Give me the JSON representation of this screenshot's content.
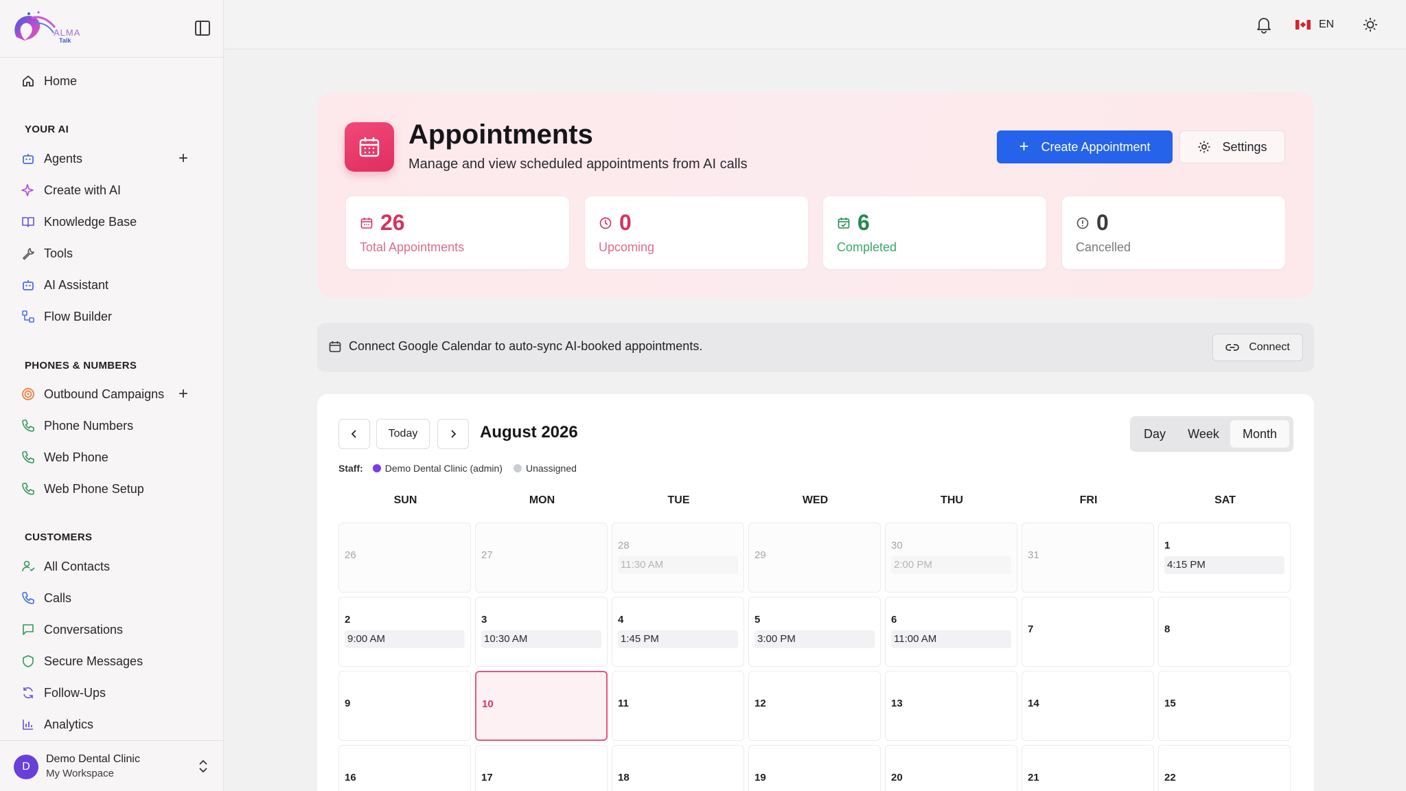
{
  "brand": {
    "logo_text": "ALMA",
    "logo_sub": "Talk"
  },
  "sidebar": {
    "home": "Home",
    "sections": {
      "your_ai": "YOUR AI",
      "phones": "PHONES & NUMBERS",
      "customers": "CUSTOMERS"
    },
    "your_ai": [
      "Agents",
      "Create with AI",
      "Knowledge Base",
      "Tools",
      "AI Assistant",
      "Flow Builder"
    ],
    "phones": [
      "Outbound Campaigns",
      "Phone Numbers",
      "Web Phone",
      "Web Phone Setup"
    ],
    "customers": [
      "All Contacts",
      "Calls",
      "Conversations",
      "Secure Messages",
      "Follow-Ups",
      "Analytics"
    ],
    "workspace": {
      "avatar": "D",
      "name": "Demo Dental Clinic",
      "sub": "My Workspace"
    }
  },
  "topbar": {
    "language": "EN"
  },
  "hero": {
    "title": "Appointments",
    "subtitle": "Manage and view scheduled appointments from AI calls",
    "create_label": "Create Appointment",
    "settings_label": "Settings",
    "stats": [
      {
        "value": "26",
        "label": "Total Appointments",
        "color": "#d6335f"
      },
      {
        "value": "0",
        "label": "Upcoming",
        "color": "#d6335f"
      },
      {
        "value": "6",
        "label": "Completed",
        "color": "#1f8a4c"
      },
      {
        "value": "0",
        "label": "Cancelled",
        "color": "#55555b"
      }
    ]
  },
  "gcal": {
    "text": "Connect Google Calendar to auto-sync AI-booked appointments.",
    "connect_label": "Connect"
  },
  "calendar": {
    "today_label": "Today",
    "month_title": "August 2026",
    "views": [
      "Day",
      "Week",
      "Month"
    ],
    "active_view": "Month",
    "staff_label": "Staff:",
    "staff": [
      {
        "name": "Demo Dental Clinic (admin)",
        "color": "#7c3aed"
      },
      {
        "name": "Unassigned",
        "color": "#c9cdd3"
      }
    ],
    "day_headers": [
      "SUN",
      "MON",
      "TUE",
      "WED",
      "THU",
      "FRI",
      "SAT"
    ],
    "weeks": [
      [
        {
          "d": "26",
          "m": true
        },
        {
          "d": "27",
          "m": true
        },
        {
          "d": "28",
          "m": true,
          "e": "11:30 AM"
        },
        {
          "d": "29",
          "m": true
        },
        {
          "d": "30",
          "m": true,
          "e": "2:00 PM"
        },
        {
          "d": "31",
          "m": true
        },
        {
          "d": "1",
          "e": "4:15 PM"
        }
      ],
      [
        {
          "d": "2",
          "e": "9:00 AM"
        },
        {
          "d": "3",
          "e": "10:30 AM"
        },
        {
          "d": "4",
          "e": "1:45 PM"
        },
        {
          "d": "5",
          "e": "3:00 PM"
        },
        {
          "d": "6",
          "e": "11:00 AM"
        },
        {
          "d": "7"
        },
        {
          "d": "8"
        }
      ],
      [
        {
          "d": "9"
        },
        {
          "d": "10",
          "t": true
        },
        {
          "d": "11"
        },
        {
          "d": "12"
        },
        {
          "d": "13"
        },
        {
          "d": "14"
        },
        {
          "d": "15"
        }
      ],
      [
        {
          "d": "16"
        },
        {
          "d": "17"
        },
        {
          "d": "18"
        },
        {
          "d": "19"
        },
        {
          "d": "20"
        },
        {
          "d": "21"
        },
        {
          "d": "22"
        }
      ]
    ]
  }
}
